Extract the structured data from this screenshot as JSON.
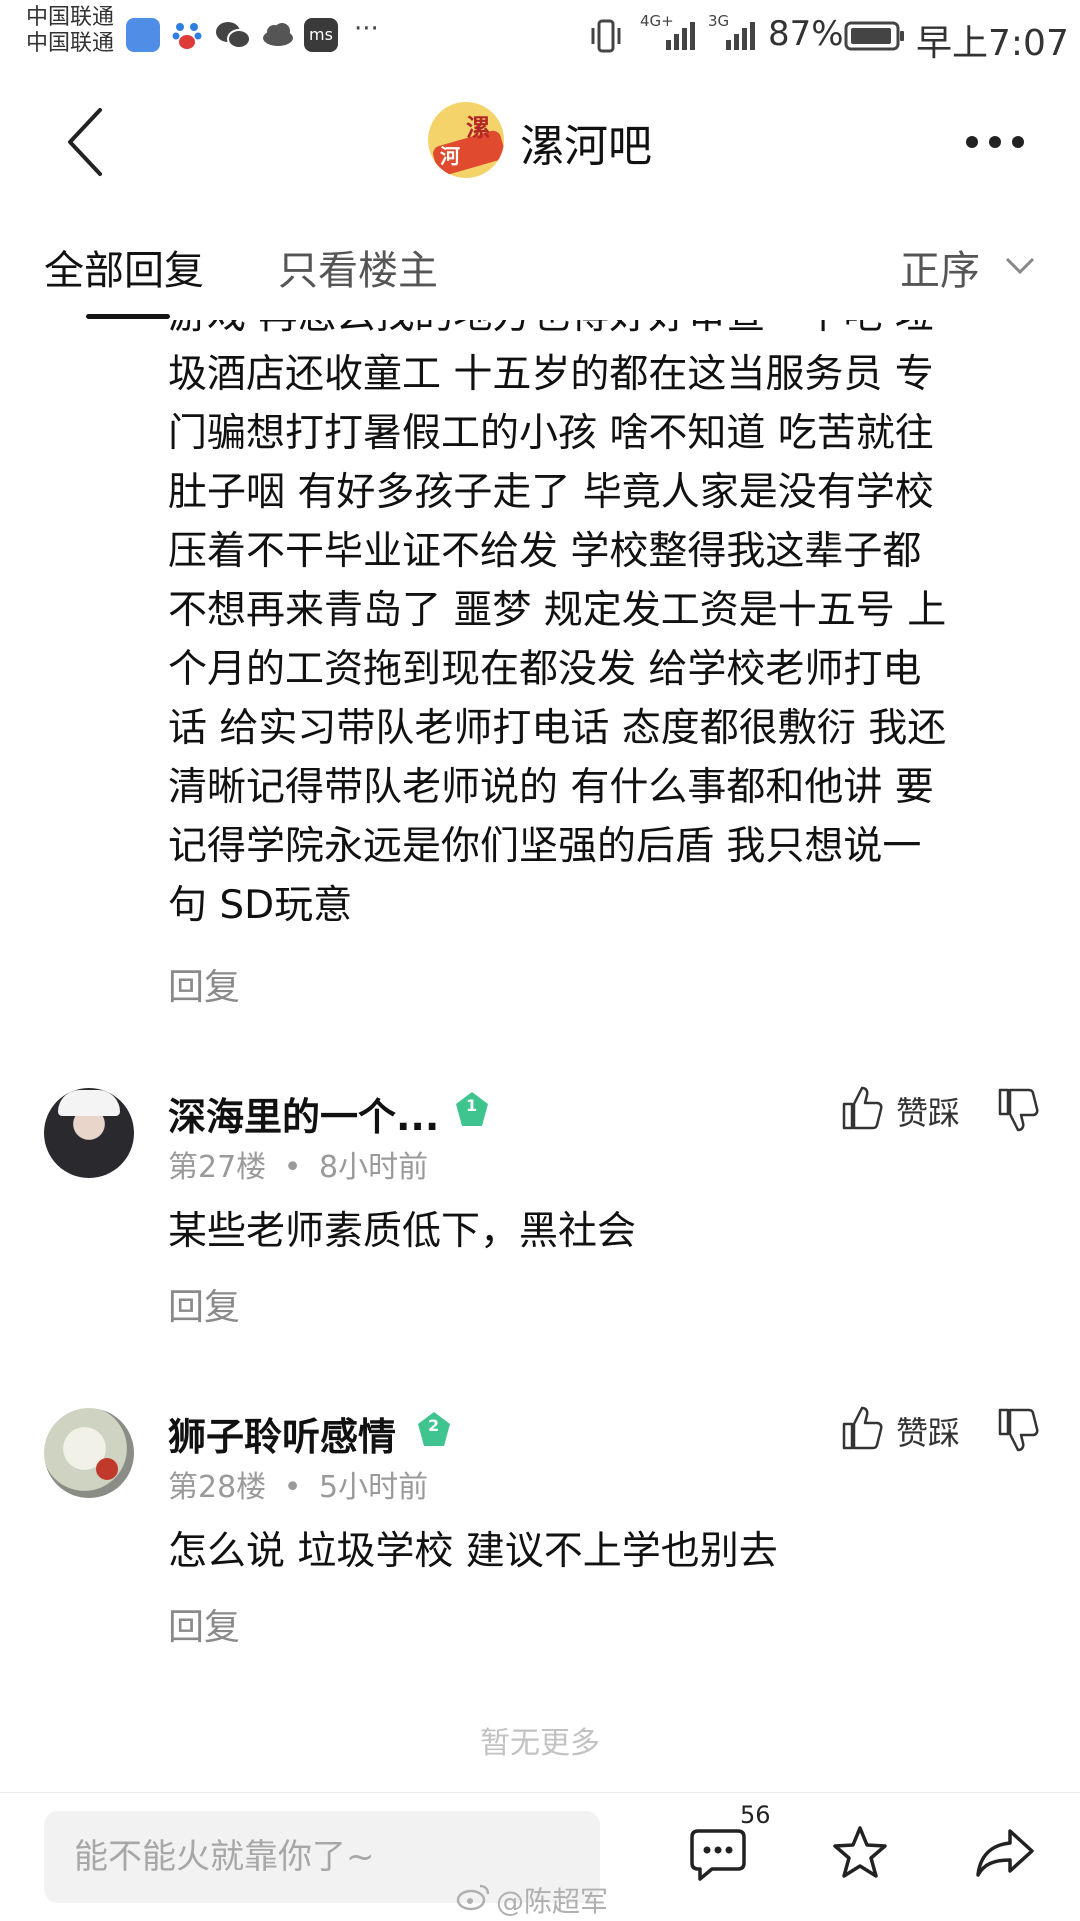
{
  "status_bar": {
    "carrier_1": "中国联通",
    "carrier_2": "中国联通",
    "network_1": "4G+",
    "network_2": "3G",
    "battery": "87%",
    "time": "早上7:07",
    "more": "···"
  },
  "header": {
    "forum_name": "漯河吧",
    "logo_char_1": "漯",
    "logo_char_2": "河"
  },
  "tabs": {
    "all_replies": "全部回复",
    "op_only": "只看楼主",
    "sort": "正序"
  },
  "post_continuation": {
    "lines": [
      "游戏 再怎么找的地方也得好好审查一下吧 垃",
      "圾酒店还收童工 十五岁的都在这当服务员 专",
      "门骗想打打暑假工的小孩 啥不知道 吃苦就往",
      "肚子咽 有好多孩子走了 毕竟人家是没有学校",
      "压着不干毕业证不给发 学校整得我这辈子都",
      "不想再来青岛了 噩梦 规定发工资是十五号 上",
      "个月的工资拖到现在都没发 给学校老师打电",
      "话 给实习带队老师打电话 态度都很敷衍 我还",
      "清晰记得带队老师说的 有什么事都和他讲 要",
      "记得学院永远是你们坚强的后盾 我只想说一",
      "句 SD玩意"
    ],
    "reply_label": "回复"
  },
  "comments": [
    {
      "username": "深海里的一个...",
      "level": "1",
      "floor": "第27楼",
      "dot": "•",
      "time": "8小时前",
      "text": "某些老师素质低下，黑社会",
      "reply_label": "回复",
      "vote_label": "赞踩"
    },
    {
      "username": "狮子聆听感情",
      "level": "2",
      "floor": "第28楼",
      "dot": "•",
      "time": "5小时前",
      "text": "怎么说 垃圾学校 建议不上学也别去",
      "reply_label": "回复",
      "vote_label": "赞踩"
    }
  ],
  "footer_note": "暂无更多",
  "bottom_bar": {
    "reply_placeholder": "能不能火就靠你了~",
    "comment_count": "56"
  },
  "watermark": "@陈超军",
  "colors": {
    "level_badge": "#3fc48f",
    "text_primary": "#111111",
    "text_secondary": "#9a9a9a",
    "tab_indicator": "#141414"
  }
}
